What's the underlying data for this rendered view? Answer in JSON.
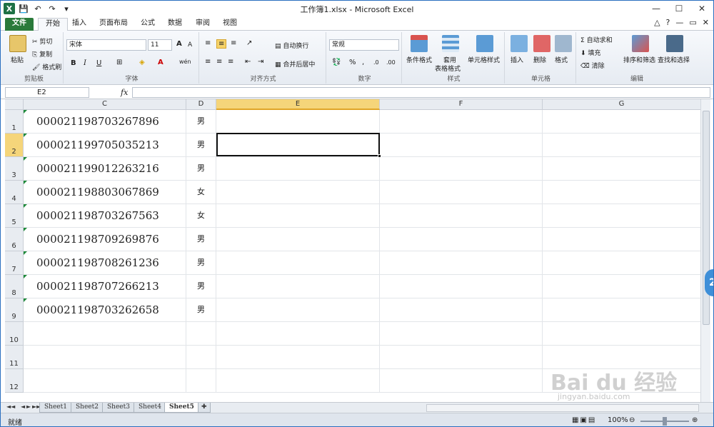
{
  "window": {
    "title": "工作簿1.xlsx - Microsoft Excel",
    "minimize_glyph": "—",
    "maximize_glyph": "☐",
    "close_glyph": "✕"
  },
  "qat": {
    "excel_logo": "X",
    "save_glyph": "💾",
    "undo_glyph": "↶",
    "redo_glyph": "↷",
    "more_glyph": "▾"
  },
  "tabs": [
    {
      "label": "文件"
    },
    {
      "label": "开始"
    },
    {
      "label": "插入"
    },
    {
      "label": "页面布局"
    },
    {
      "label": "公式"
    },
    {
      "label": "数据"
    },
    {
      "label": "审阅"
    },
    {
      "label": "视图"
    }
  ],
  "ribbon_controls": {
    "collapse": "△",
    "help": "?",
    "min": "—",
    "restore": "▭",
    "close": "✕"
  },
  "ribbon": {
    "clipboard": {
      "label": "剪贴板",
      "paste": "粘贴",
      "cut": "剪切",
      "copy": "复制",
      "format_painter": "格式刷"
    },
    "font": {
      "label": "字体",
      "font_name": "宋体",
      "font_size": "11",
      "grow": "A",
      "shrink": "A",
      "bold": "B",
      "italic": "I",
      "underline": "U",
      "wen": "wén"
    },
    "alignment": {
      "label": "对齐方式",
      "wrap": "自动换行",
      "merge": "合并后居中"
    },
    "number": {
      "label": "数字",
      "format": "常规",
      "percent": "%",
      "comma": ",",
      "inc_dec": ".0",
      "dec_dec": ".00"
    },
    "styles": {
      "label": "样式",
      "conditional": "条件格式",
      "table_1": "套用",
      "table_2": "表格格式",
      "cell_styles": "单元格样式"
    },
    "cells": {
      "label": "单元格",
      "insert": "插入",
      "delete": "删除",
      "format": "格式"
    },
    "editing": {
      "label": "编辑",
      "autosum": "自动求和",
      "fill": "填充",
      "clear": "清除",
      "sort": "排序和筛选",
      "find": "查找和选择",
      "sigma": "Σ"
    }
  },
  "formula_bar": {
    "name_box": "E2",
    "fx": "fx",
    "content": ""
  },
  "columns": [
    {
      "label": "C"
    },
    {
      "label": "D"
    },
    {
      "label": "E"
    },
    {
      "label": "F"
    },
    {
      "label": "G"
    }
  ],
  "rows": [
    {
      "num": "1",
      "id": "000021198703267896",
      "gender": "男"
    },
    {
      "num": "2",
      "id": "000021199705035213",
      "gender": "男"
    },
    {
      "num": "3",
      "id": "000021199012263216",
      "gender": "男"
    },
    {
      "num": "4",
      "id": "000021198803067869",
      "gender": "女"
    },
    {
      "num": "5",
      "id": "000021198703267563",
      "gender": "女"
    },
    {
      "num": "6",
      "id": "000021198709269876",
      "gender": "男"
    },
    {
      "num": "7",
      "id": "000021198708261236",
      "gender": "男"
    },
    {
      "num": "8",
      "id": "000021198707266213",
      "gender": "男"
    },
    {
      "num": "9",
      "id": "000021198703262658",
      "gender": "男"
    },
    {
      "num": "10",
      "id": "",
      "gender": ""
    },
    {
      "num": "11",
      "id": "",
      "gender": ""
    },
    {
      "num": "12",
      "id": "",
      "gender": ""
    }
  ],
  "sheets": [
    {
      "label": "Sheet1"
    },
    {
      "label": "Sheet2"
    },
    {
      "label": "Sheet3"
    },
    {
      "label": "Sheet4"
    },
    {
      "label": "Sheet5"
    }
  ],
  "sheet_nav": {
    "first": "◄◄",
    "prev": "◄",
    "next": "►",
    "last": "►►"
  },
  "status": {
    "ready": "就绪",
    "zoom": "100%",
    "zoom_minus": "⊖",
    "zoom_plus": "⊕"
  },
  "floating_badge": "2",
  "watermark": {
    "main": "Bai du 经验",
    "sub": "jingyan.baidu.com"
  },
  "colors": {
    "accent": "#2a7a3a",
    "selected_header": "#f5d57a",
    "title_border": "#2a6fbf"
  }
}
